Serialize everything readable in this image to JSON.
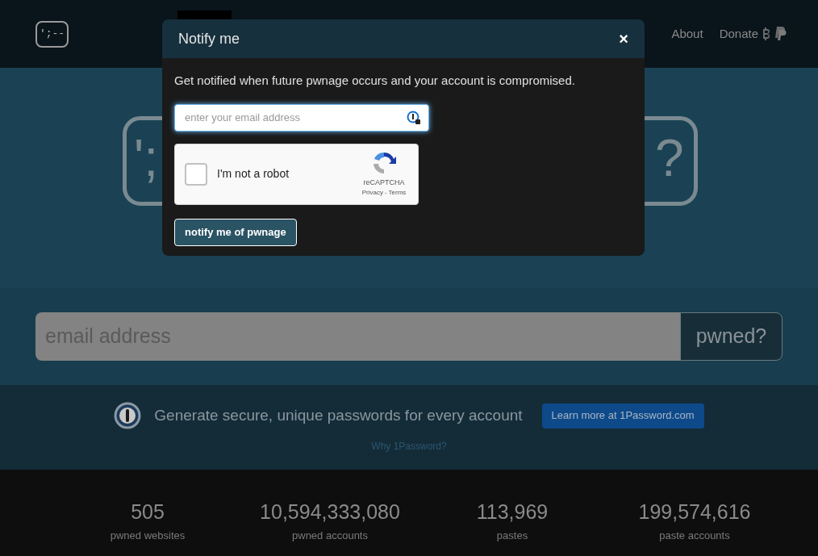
{
  "nav": {
    "logo": "';--",
    "links": [
      "About",
      "Donate"
    ]
  },
  "hero": {
    "left_text": "';",
    "right_text": "?"
  },
  "search": {
    "placeholder": "email address",
    "button": "pwned?"
  },
  "promo": {
    "text": "Generate secure, unique passwords for every account",
    "button": "Learn more at 1Password.com",
    "link": "Why 1Password?"
  },
  "stats": [
    {
      "value": "505",
      "label": "pwned websites"
    },
    {
      "value": "10,594,333,080",
      "label": "pwned accounts"
    },
    {
      "value": "113,969",
      "label": "pastes"
    },
    {
      "value": "199,574,616",
      "label": "paste accounts"
    }
  ],
  "modal": {
    "title": "Notify me",
    "close": "×",
    "description": "Get notified when future pwnage occurs and your account is compromised.",
    "email_placeholder": "enter your email address",
    "captcha": {
      "label": "I'm not a robot",
      "checked": false,
      "brand": "reCAPTCHA",
      "privacy": "Privacy",
      "separator": "-",
      "terms": "Terms"
    },
    "submit": "notify me of pwnage"
  }
}
